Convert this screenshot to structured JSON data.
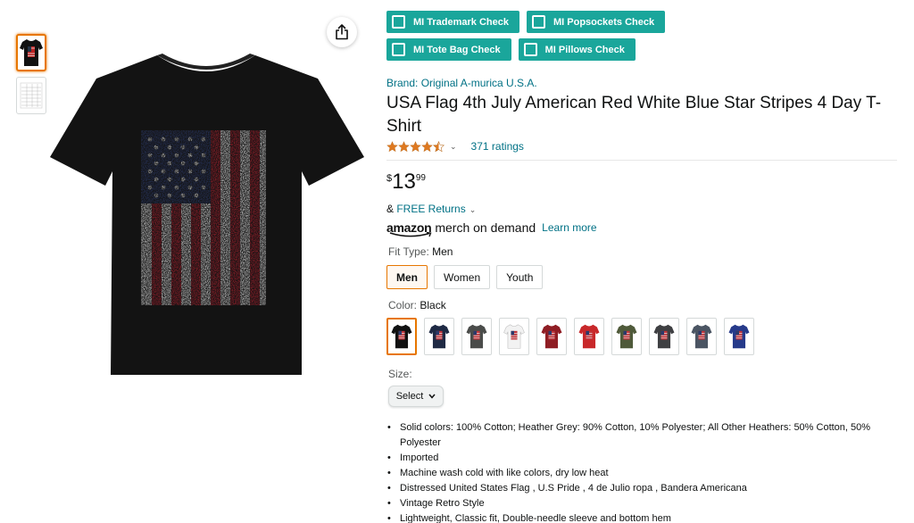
{
  "mi_buttons": [
    {
      "label": "MI Trademark Check"
    },
    {
      "label": "MI Popsockets Check"
    },
    {
      "label": "MI Tote Bag Check"
    },
    {
      "label": "MI Pillows Check"
    }
  ],
  "product": {
    "brand": "Brand: Original A-murica U.S.A.",
    "title": "USA Flag 4th July American Red White Blue Star Stripes 4 Day T-Shirt",
    "rating_stars": 4.5,
    "ratings_text": "371 ratings",
    "price": {
      "symbol": "$",
      "whole": "13",
      "fraction": "99"
    },
    "returns_prefix": "& ",
    "returns_link": "FREE Returns",
    "merch": {
      "logo": "amazon",
      "text": "merch on demand",
      "learn_more": "Learn more"
    }
  },
  "fit_type": {
    "label": "Fit Type: ",
    "value": "Men",
    "options": [
      "Men",
      "Women",
      "Youth"
    ],
    "selected": "Men"
  },
  "color": {
    "label": "Color: ",
    "value": "Black",
    "swatches": [
      {
        "name": "Black",
        "hex": "#111111"
      },
      {
        "name": "Navy",
        "hex": "#1f2a44"
      },
      {
        "name": "Dark Heather",
        "hex": "#4a4c4a"
      },
      {
        "name": "White",
        "hex": "#f2f2f2"
      },
      {
        "name": "Cranberry",
        "hex": "#8f1d24"
      },
      {
        "name": "Red",
        "hex": "#c8282a"
      },
      {
        "name": "Olive",
        "hex": "#4f5a3a"
      },
      {
        "name": "Heather Grey Dark",
        "hex": "#3e3f42"
      },
      {
        "name": "Slate",
        "hex": "#4b5563"
      },
      {
        "name": "Royal Blue",
        "hex": "#263a8a"
      }
    ],
    "selected_index": 0
  },
  "size": {
    "label": "Size:",
    "select_label": "Select"
  },
  "bullets": [
    "Solid colors: 100% Cotton; Heather Grey: 90% Cotton, 10% Polyester; All Other Heathers: 50% Cotton, 50% Polyester",
    "Imported",
    "Machine wash cold with like colors, dry low heat",
    "Distressed United States Flag , U.S Pride , 4 de Julio ropa , Bandera Americana",
    "Vintage Retro Style",
    "Lightweight, Classic fit, Double-needle sleeve and bottom hem"
  ],
  "icons": {
    "share": "share-icon",
    "chevron": "chevron-down-icon",
    "star": "star-icon"
  },
  "colors": {
    "link": "#007185",
    "accent": "#e77600",
    "mi_button": "#1aa69b",
    "star": "#de7921"
  }
}
